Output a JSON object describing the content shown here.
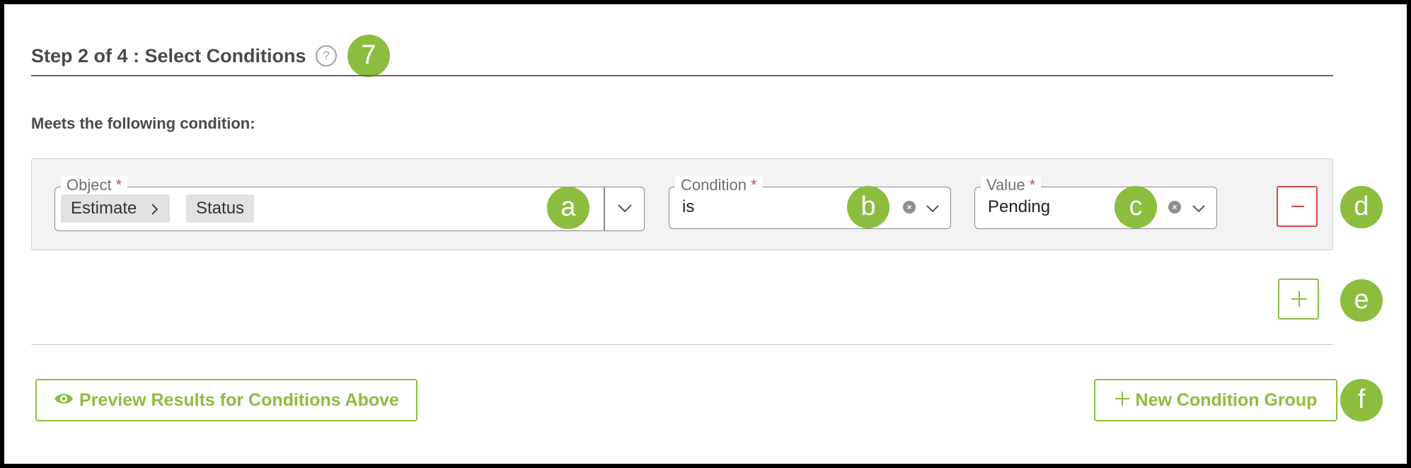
{
  "header": {
    "title": "Step 2 of 4 : Select Conditions",
    "help_icon": "help-circle-icon",
    "step_marker": "7"
  },
  "subtitle": "Meets the following condition:",
  "condition_row": {
    "object": {
      "label": "Object",
      "required_mark": "*",
      "chips": [
        "Estimate",
        "Status"
      ],
      "chip_separator_icon": "chevron-right-icon",
      "dropdown_icon": "chevron-down-icon"
    },
    "condition": {
      "label": "Condition",
      "required_mark": "*",
      "value": "is",
      "clear_icon": "clear-circle-icon",
      "dropdown_icon": "chevron-down-icon"
    },
    "value": {
      "label": "Value",
      "required_mark": "*",
      "value": "Pending",
      "clear_icon": "clear-circle-icon",
      "dropdown_icon": "chevron-down-icon"
    },
    "remove_icon": "minus-icon"
  },
  "add_condition_icon": "plus-icon",
  "buttons": {
    "preview_label": "Preview Results for Conditions Above",
    "preview_icon": "eye-icon",
    "new_group_label": "New Condition Group",
    "new_group_icon": "plus-icon"
  },
  "annotation_markers": [
    "a",
    "b",
    "c",
    "d",
    "e",
    "f"
  ],
  "colors": {
    "accent": "#8cbd3f",
    "danger": "#d14b4b",
    "panel": "#f2f2f2"
  }
}
